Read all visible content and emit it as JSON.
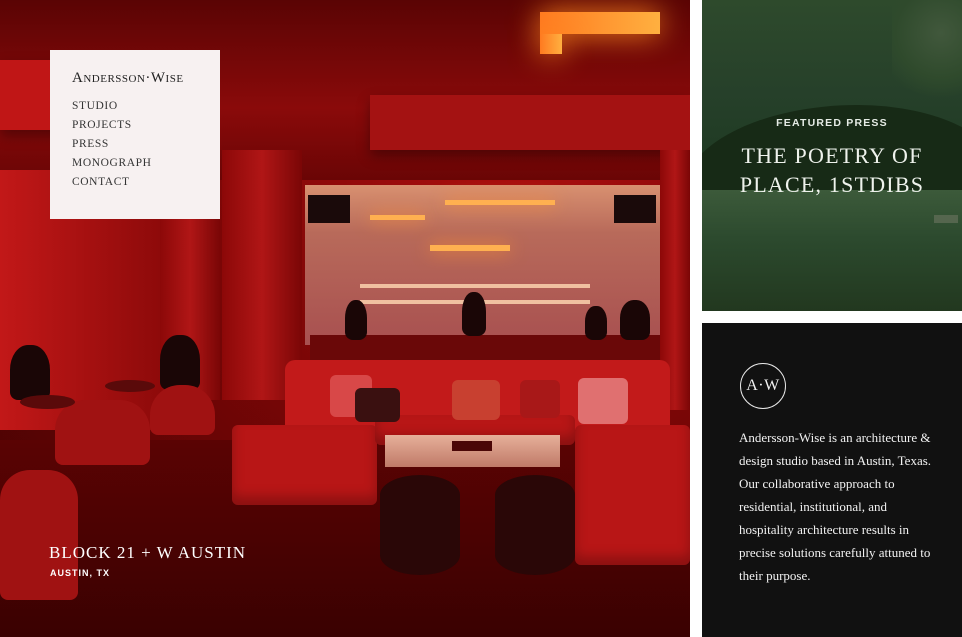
{
  "brand": {
    "name": "Andersson·Wise"
  },
  "nav": {
    "items": [
      {
        "label": "STUDIO"
      },
      {
        "label": "PROJECTS"
      },
      {
        "label": "PRESS"
      },
      {
        "label": "MONOGRAPH"
      },
      {
        "label": "CONTACT"
      }
    ]
  },
  "hero": {
    "project_title": "BLOCK 21 + W AUSTIN",
    "project_location": "AUSTIN, TX"
  },
  "featured_press": {
    "label": "FEATURED PRESS",
    "title_line1": "THE POETRY OF",
    "title_line2": "PLACE, 1STDIBS"
  },
  "about": {
    "logo_text": "A·W",
    "description": "Andersson-Wise is an architecture & design studio based in Austin, Texas. Our collaborative approach to residential, institutional, and hospitality architecture results in precise solutions carefully attuned to their purpose."
  },
  "colors": {
    "hero_red": "#b01010",
    "nav_box_bg": "#f7f1f1",
    "press_green": "#26402a",
    "about_bg": "#111111"
  }
}
